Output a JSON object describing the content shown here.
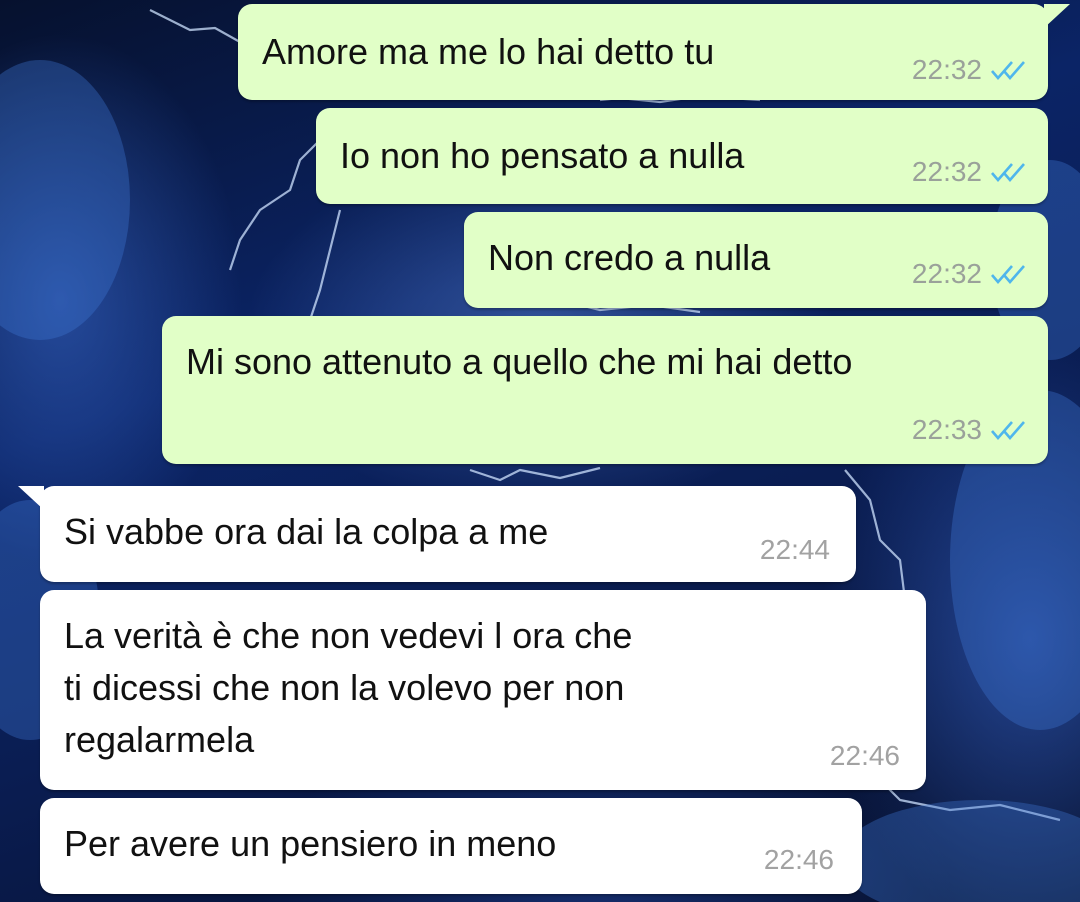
{
  "colors": {
    "outgoing_bubble": "#e1ffc7",
    "incoming_bubble": "#ffffff",
    "read_ticks": "#4fb6ec",
    "time_text": "#9aa19a"
  },
  "messages": [
    {
      "direction": "out",
      "text": "Amore ma me lo hai detto tu",
      "time": "22:32",
      "status_icon": "double-check-read-icon"
    },
    {
      "direction": "out",
      "text": "Io non ho pensato a nulla",
      "time": "22:32",
      "status_icon": "double-check-read-icon"
    },
    {
      "direction": "out",
      "text": "Non credo a nulla",
      "time": "22:32",
      "status_icon": "double-check-read-icon"
    },
    {
      "direction": "out",
      "text": "Mi sono attenuto a quello che mi hai detto",
      "time": "22:33",
      "status_icon": "double-check-read-icon"
    },
    {
      "direction": "in",
      "text": "Si vabbe ora dai la colpa a me",
      "time": "22:44"
    },
    {
      "direction": "in",
      "text": "La verità è che non vedevi l ora che\nti dicessi che non la volevo per non\nregalarmela",
      "time": "22:46"
    },
    {
      "direction": "in",
      "text": "Per avere un pensiero in meno",
      "time": "22:46"
    }
  ]
}
